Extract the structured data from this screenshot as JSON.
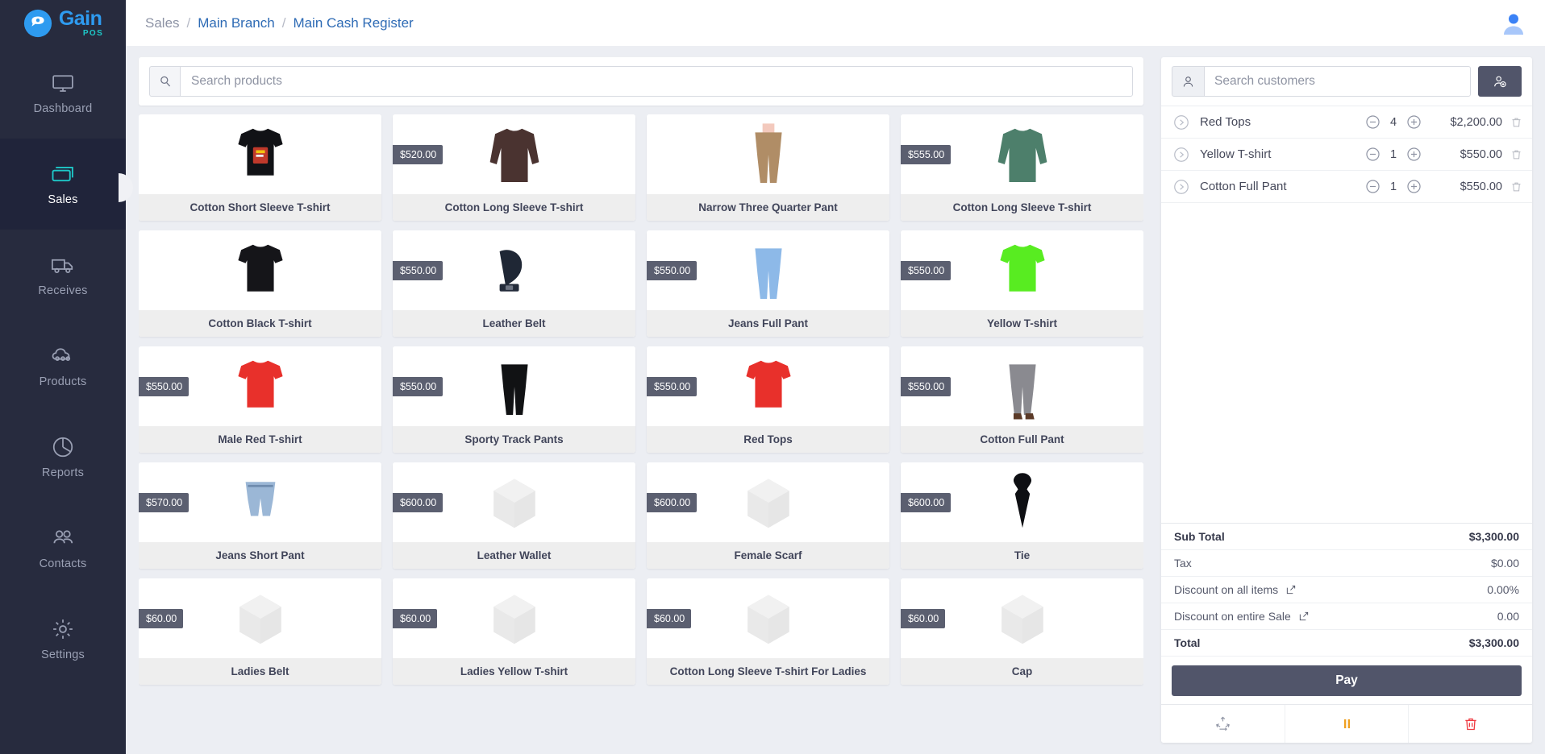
{
  "brand": {
    "name": "Gain",
    "sub": "POS",
    "logo_icon": "gain-chat-logo-icon"
  },
  "sidebar": {
    "items": [
      {
        "label": "Dashboard",
        "icon": "monitor-icon",
        "active": false
      },
      {
        "label": "Sales",
        "icon": "card-swipe-icon",
        "active": true
      },
      {
        "label": "Receives",
        "icon": "truck-icon",
        "active": false
      },
      {
        "label": "Products",
        "icon": "products-cloud-icon",
        "active": false
      },
      {
        "label": "Reports",
        "icon": "pie-chart-icon",
        "active": false
      },
      {
        "label": "Contacts",
        "icon": "people-icon",
        "active": false
      },
      {
        "label": "Settings",
        "icon": "gear-icon",
        "active": false
      }
    ]
  },
  "header": {
    "breadcrumb": [
      {
        "text": "Sales",
        "type": "muted"
      },
      {
        "text": "Main Branch",
        "type": "link"
      },
      {
        "text": "Main Cash Register",
        "type": "link"
      }
    ],
    "separator": "/",
    "avatar_icon": "user-avatar-icon"
  },
  "product_search": {
    "placeholder": "Search products",
    "value": "",
    "icon": "search-icon"
  },
  "products": [
    {
      "name": "Cotton Short Sleeve T-shirt",
      "price": "",
      "image": "black-graphic-tshirt"
    },
    {
      "name": "Cotton Long Sleeve T-shirt",
      "price": "$520.00",
      "image": "brown-longsleeve"
    },
    {
      "name": "Narrow Three Quarter Pant",
      "price": "",
      "image": "tan-pants-model"
    },
    {
      "name": "Cotton Long Sleeve T-shirt",
      "price": "$555.00",
      "image": "green-longsleeve"
    },
    {
      "name": "Cotton Black T-shirt",
      "price": "",
      "image": "black-tshirt"
    },
    {
      "name": "Leather Belt",
      "price": "$550.00",
      "image": "navy-leather-belt"
    },
    {
      "name": "Jeans Full Pant",
      "price": "$550.00",
      "image": "blue-jeans"
    },
    {
      "name": "Yellow T-shirt",
      "price": "$550.00",
      "image": "neon-green-tshirt"
    },
    {
      "name": "Male Red T-shirt",
      "price": "$550.00",
      "image": "red-tshirt"
    },
    {
      "name": "Sporty Track Pants",
      "price": "$550.00",
      "image": "black-leggings"
    },
    {
      "name": "Red Tops",
      "price": "$550.00",
      "image": "red-top"
    },
    {
      "name": "Cotton Full Pant",
      "price": "$550.00",
      "image": "grey-pant-heels"
    },
    {
      "name": "Jeans Short Pant",
      "price": "$570.00",
      "image": "denim-shorts"
    },
    {
      "name": "Leather Wallet",
      "price": "$600.00",
      "image": "placeholder-box"
    },
    {
      "name": "Female Scarf",
      "price": "$600.00",
      "image": "placeholder-box"
    },
    {
      "name": "Tie",
      "price": "$600.00",
      "image": "black-tie"
    },
    {
      "name": "Ladies Belt",
      "price": "$60.00",
      "image": "placeholder-box"
    },
    {
      "name": "Ladies Yellow T-shirt",
      "price": "$60.00",
      "image": "placeholder-box"
    },
    {
      "name": "Cotton Long Sleeve T-shirt For Ladies",
      "price": "$60.00",
      "image": "placeholder-box"
    },
    {
      "name": "Cap",
      "price": "$60.00",
      "image": "placeholder-box"
    }
  ],
  "customer_search": {
    "placeholder": "Search customers",
    "value": "",
    "icon": "person-icon",
    "add_button_icon": "add-person-icon"
  },
  "cart": {
    "items": [
      {
        "name": "Red Tops",
        "qty": "4",
        "price": "$2,200.00"
      },
      {
        "name": "Yellow T-shirt",
        "qty": "1",
        "price": "$550.00"
      },
      {
        "name": "Cotton Full Pant",
        "qty": "1",
        "price": "$550.00"
      }
    ],
    "totals": [
      {
        "label": "Sub Total",
        "value": "$3,300.00",
        "bold": true,
        "edit": false
      },
      {
        "label": "Tax",
        "value": "$0.00",
        "bold": false,
        "edit": false
      },
      {
        "label": "Discount on all items",
        "value": "0.00%",
        "bold": false,
        "edit": true
      },
      {
        "label": "Discount on entire Sale",
        "value": "0.00",
        "bold": false,
        "edit": true
      },
      {
        "label": "Total",
        "value": "$3,300.00",
        "bold": true,
        "edit": false
      }
    ],
    "pay_label": "Pay",
    "actions": [
      {
        "icon": "recycle-refund-icon",
        "color": "#8e93a3"
      },
      {
        "icon": "pause-icon",
        "color": "#f0a020"
      },
      {
        "icon": "trash-icon",
        "color": "#ef3b42"
      }
    ]
  },
  "colors": {
    "sidebar_bg": "#272b3e",
    "sidebar_active_bg": "#20243a",
    "brand_blue": "#2e9bf0",
    "brand_teal": "#1ec8c8",
    "page_bg": "#eceef3",
    "price_badge": "#5b5f70",
    "pay_button": "#51556a",
    "link_blue": "#2e6bb5",
    "pause_orange": "#f0a020",
    "trash_red": "#ef3b42"
  }
}
